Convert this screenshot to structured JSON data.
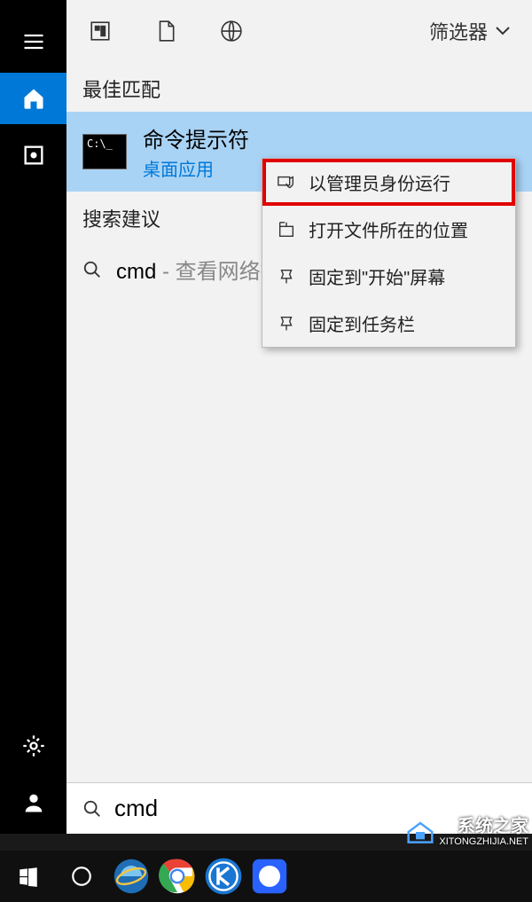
{
  "topbar": {
    "filter_label": "筛选器"
  },
  "sections": {
    "best_match": "最佳匹配",
    "search_suggestions": "搜索建议"
  },
  "result": {
    "title": "命令提示符",
    "subtitle": "桌面应用",
    "icon_text": "C:\\_"
  },
  "suggestion": {
    "query": "cmd",
    "hint": " - 查看网络搜"
  },
  "context_menu": {
    "items": [
      {
        "label": "以管理员身份运行",
        "highlighted": true,
        "icon": "shield"
      },
      {
        "label": "打开文件所在的位置",
        "highlighted": false,
        "icon": "folder"
      },
      {
        "label": "固定到\"开始\"屏幕",
        "highlighted": false,
        "icon": "pin"
      },
      {
        "label": "固定到任务栏",
        "highlighted": false,
        "icon": "pin"
      }
    ]
  },
  "search_input": {
    "value": "cmd"
  },
  "watermark": {
    "title": "系统之家",
    "url": "XITONGZHIJIA.NET"
  }
}
